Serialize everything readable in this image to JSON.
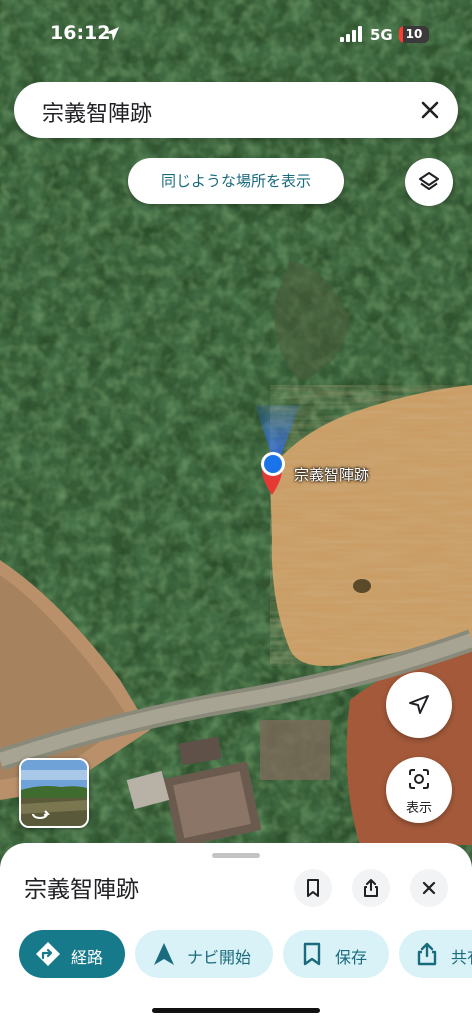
{
  "status_bar": {
    "time": "16:12",
    "network": "5G",
    "battery": "10"
  },
  "search": {
    "query": "宗義智陣跡"
  },
  "map": {
    "chip_label": "同じような場所を表示",
    "pin_label": "宗義智陣跡",
    "lens_label": "表示"
  },
  "place_sheet": {
    "title": "宗義智陣跡",
    "actions": [
      {
        "label": "経路",
        "icon": "directions-icon"
      },
      {
        "label": "ナビ開始",
        "icon": "navigation-arrow-icon"
      },
      {
        "label": "保存",
        "icon": "bookmark-icon"
      },
      {
        "label": "共有",
        "icon": "share-icon"
      }
    ]
  },
  "colors": {
    "accent": "#167a8b",
    "pill_background": "#d9f2f7",
    "pin": "#e53935",
    "location_dot": "#1a73e8"
  }
}
